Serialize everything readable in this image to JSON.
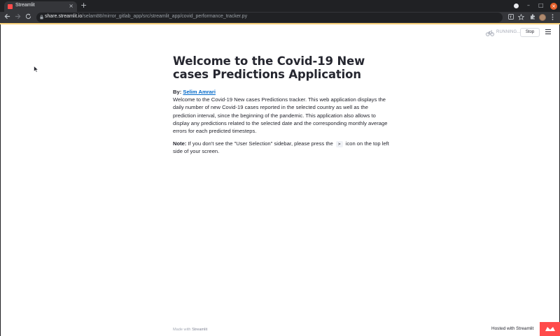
{
  "browser": {
    "tab_title": "Streamlit",
    "tab_close": "×",
    "new_tab": "+",
    "url_host": "share.streamlit.io",
    "url_path": "/selam88/mirror_gitlab_app/src/streamlit_app/covid_performance_tracker.py",
    "min_glyph": "–",
    "max_glyph": "□",
    "close_glyph": "×"
  },
  "header": {
    "status_text": "RUNNING...",
    "stop_label": "Stop"
  },
  "main": {
    "title": "Welcome to the Covid-19 New cases Predictions Application",
    "by_label": "By:",
    "author": "Selim Amrari",
    "description": "Welcome to the Covid-19 New cases Predictions tracker. This web application displays the daily number of new Covid-19 cases reported in the selected country as well as the prediction interval, since the beginning of the pandemic. This application also allows to display any predictions related to the selected date and the corresponding monthly average errors for each predicted timesteps.",
    "note_label": "Note:",
    "note_before": "If you don't see the \"User Selection\" sidebar, please press the",
    "note_icon": ">",
    "note_after": "icon on the top left side of your screen."
  },
  "footer": {
    "made_with": "Made with",
    "brand": "Streamlit",
    "hosted_with": "Hosted with Streamlit"
  },
  "colors": {
    "accent": "#ff4b4b",
    "link": "#0068c9",
    "text": "#262730",
    "chrome": "#202124"
  },
  "icons": [
    "back-arrow-icon",
    "forward-arrow-icon",
    "reload-icon",
    "lock-icon",
    "translate-icon",
    "star-icon",
    "extensions-icon",
    "kebab-menu-icon",
    "bike-icon",
    "hamburger-menu-icon",
    "cursor-icon"
  ]
}
